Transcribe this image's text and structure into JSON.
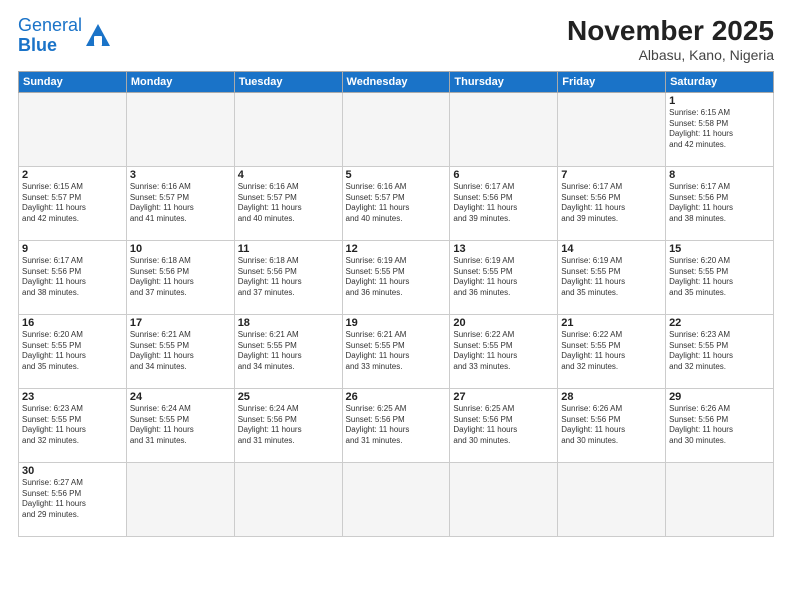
{
  "logo": {
    "general": "General",
    "blue": "Blue"
  },
  "title": "November 2025",
  "subtitle": "Albasu, Kano, Nigeria",
  "weekdays": [
    "Sunday",
    "Monday",
    "Tuesday",
    "Wednesday",
    "Thursday",
    "Friday",
    "Saturday"
  ],
  "weeks": [
    [
      {
        "day": "",
        "info": ""
      },
      {
        "day": "",
        "info": ""
      },
      {
        "day": "",
        "info": ""
      },
      {
        "day": "",
        "info": ""
      },
      {
        "day": "",
        "info": ""
      },
      {
        "day": "",
        "info": ""
      },
      {
        "day": "1",
        "info": "Sunrise: 6:15 AM\nSunset: 5:58 PM\nDaylight: 11 hours\nand 42 minutes."
      }
    ],
    [
      {
        "day": "2",
        "info": "Sunrise: 6:15 AM\nSunset: 5:57 PM\nDaylight: 11 hours\nand 42 minutes."
      },
      {
        "day": "3",
        "info": "Sunrise: 6:16 AM\nSunset: 5:57 PM\nDaylight: 11 hours\nand 41 minutes."
      },
      {
        "day": "4",
        "info": "Sunrise: 6:16 AM\nSunset: 5:57 PM\nDaylight: 11 hours\nand 40 minutes."
      },
      {
        "day": "5",
        "info": "Sunrise: 6:16 AM\nSunset: 5:57 PM\nDaylight: 11 hours\nand 40 minutes."
      },
      {
        "day": "6",
        "info": "Sunrise: 6:17 AM\nSunset: 5:56 PM\nDaylight: 11 hours\nand 39 minutes."
      },
      {
        "day": "7",
        "info": "Sunrise: 6:17 AM\nSunset: 5:56 PM\nDaylight: 11 hours\nand 39 minutes."
      },
      {
        "day": "8",
        "info": "Sunrise: 6:17 AM\nSunset: 5:56 PM\nDaylight: 11 hours\nand 38 minutes."
      }
    ],
    [
      {
        "day": "9",
        "info": "Sunrise: 6:17 AM\nSunset: 5:56 PM\nDaylight: 11 hours\nand 38 minutes."
      },
      {
        "day": "10",
        "info": "Sunrise: 6:18 AM\nSunset: 5:56 PM\nDaylight: 11 hours\nand 37 minutes."
      },
      {
        "day": "11",
        "info": "Sunrise: 6:18 AM\nSunset: 5:56 PM\nDaylight: 11 hours\nand 37 minutes."
      },
      {
        "day": "12",
        "info": "Sunrise: 6:19 AM\nSunset: 5:55 PM\nDaylight: 11 hours\nand 36 minutes."
      },
      {
        "day": "13",
        "info": "Sunrise: 6:19 AM\nSunset: 5:55 PM\nDaylight: 11 hours\nand 36 minutes."
      },
      {
        "day": "14",
        "info": "Sunrise: 6:19 AM\nSunset: 5:55 PM\nDaylight: 11 hours\nand 35 minutes."
      },
      {
        "day": "15",
        "info": "Sunrise: 6:20 AM\nSunset: 5:55 PM\nDaylight: 11 hours\nand 35 minutes."
      }
    ],
    [
      {
        "day": "16",
        "info": "Sunrise: 6:20 AM\nSunset: 5:55 PM\nDaylight: 11 hours\nand 35 minutes."
      },
      {
        "day": "17",
        "info": "Sunrise: 6:21 AM\nSunset: 5:55 PM\nDaylight: 11 hours\nand 34 minutes."
      },
      {
        "day": "18",
        "info": "Sunrise: 6:21 AM\nSunset: 5:55 PM\nDaylight: 11 hours\nand 34 minutes."
      },
      {
        "day": "19",
        "info": "Sunrise: 6:21 AM\nSunset: 5:55 PM\nDaylight: 11 hours\nand 33 minutes."
      },
      {
        "day": "20",
        "info": "Sunrise: 6:22 AM\nSunset: 5:55 PM\nDaylight: 11 hours\nand 33 minutes."
      },
      {
        "day": "21",
        "info": "Sunrise: 6:22 AM\nSunset: 5:55 PM\nDaylight: 11 hours\nand 32 minutes."
      },
      {
        "day": "22",
        "info": "Sunrise: 6:23 AM\nSunset: 5:55 PM\nDaylight: 11 hours\nand 32 minutes."
      }
    ],
    [
      {
        "day": "23",
        "info": "Sunrise: 6:23 AM\nSunset: 5:55 PM\nDaylight: 11 hours\nand 32 minutes."
      },
      {
        "day": "24",
        "info": "Sunrise: 6:24 AM\nSunset: 5:55 PM\nDaylight: 11 hours\nand 31 minutes."
      },
      {
        "day": "25",
        "info": "Sunrise: 6:24 AM\nSunset: 5:56 PM\nDaylight: 11 hours\nand 31 minutes."
      },
      {
        "day": "26",
        "info": "Sunrise: 6:25 AM\nSunset: 5:56 PM\nDaylight: 11 hours\nand 31 minutes."
      },
      {
        "day": "27",
        "info": "Sunrise: 6:25 AM\nSunset: 5:56 PM\nDaylight: 11 hours\nand 30 minutes."
      },
      {
        "day": "28",
        "info": "Sunrise: 6:26 AM\nSunset: 5:56 PM\nDaylight: 11 hours\nand 30 minutes."
      },
      {
        "day": "29",
        "info": "Sunrise: 6:26 AM\nSunset: 5:56 PM\nDaylight: 11 hours\nand 30 minutes."
      }
    ],
    [
      {
        "day": "30",
        "info": "Sunrise: 6:27 AM\nSunset: 5:56 PM\nDaylight: 11 hours\nand 29 minutes."
      },
      {
        "day": "",
        "info": ""
      },
      {
        "day": "",
        "info": ""
      },
      {
        "day": "",
        "info": ""
      },
      {
        "day": "",
        "info": ""
      },
      {
        "day": "",
        "info": ""
      },
      {
        "day": "",
        "info": ""
      }
    ]
  ]
}
